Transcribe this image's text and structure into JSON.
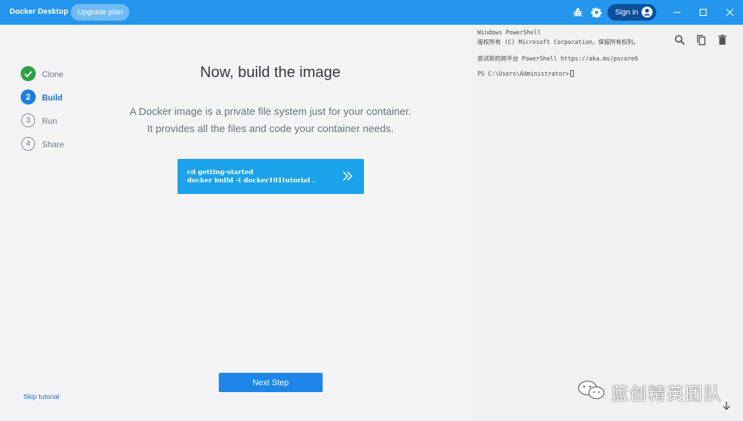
{
  "titlebar": {
    "app_title": "Docker Desktop",
    "upgrade_label": "Upgrade plan",
    "signin_label": "Sign in",
    "icons": [
      "bug-icon",
      "gear-icon",
      "account-icon",
      "minimize-icon",
      "maximize-icon",
      "close-icon"
    ]
  },
  "steps": [
    {
      "number": "1",
      "label": "Clone",
      "state": "done"
    },
    {
      "number": "2",
      "label": "Build",
      "state": "active"
    },
    {
      "number": "3",
      "label": "Run",
      "state": "todo"
    },
    {
      "number": "4",
      "label": "Share",
      "state": "todo"
    }
  ],
  "skip_label": "Skip tutorial",
  "main": {
    "title": "Now, build the image",
    "description_line1": "A Docker image is a private file system just for your container.",
    "description_line2": "It provides all the files and code your container needs.",
    "command_line1": "cd getting-started",
    "command_line2": "docker build -t docker101tutorial .",
    "next_label": "Next Step"
  },
  "terminal": {
    "line1": "Windows PowerShell",
    "line2": "版权所有 (C) Microsoft Corporation。保留所有权利。",
    "line3": "尝试新的跨平台 PowerShell https://aka.ms/pscore6",
    "prompt": "PS C:\\Users\\Administrator>",
    "tools": [
      "search-icon",
      "copy-icon",
      "trash-icon"
    ]
  },
  "watermark": "蓝创精英团队",
  "colors": {
    "titlebar": "#2496ed",
    "accent": "#1d86e8",
    "command_bg": "#1aa3eb",
    "done": "#2ea043"
  }
}
